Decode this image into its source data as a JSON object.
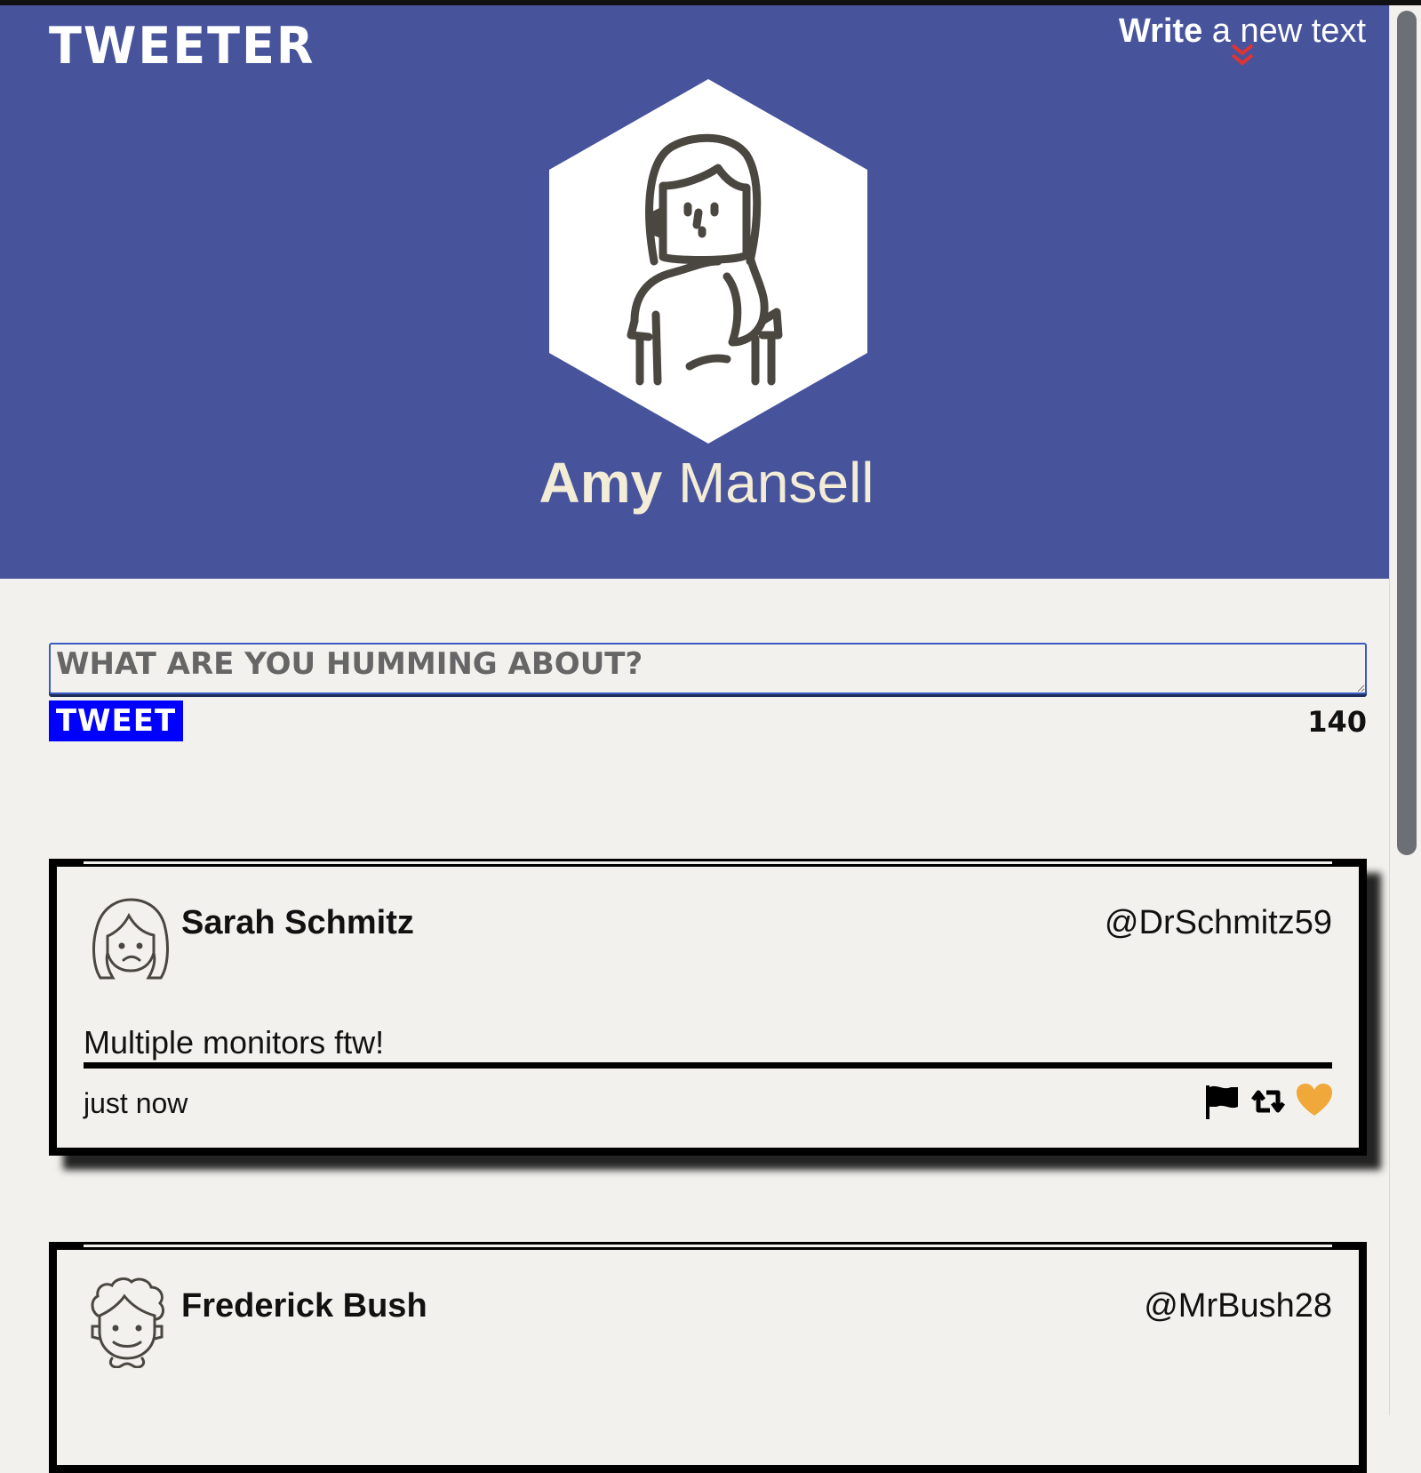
{
  "app": {
    "logo": "Tweeter"
  },
  "header": {
    "compose_link_bold": "Write",
    "compose_link_rest": " a new text",
    "compose_chevron_icon": "double-chevron-down-icon",
    "chevron_color": "#e03333",
    "background_color": "#47549c"
  },
  "profile": {
    "first_name": "Amy",
    "last_name": " Mansell",
    "avatar_icon": "woman-avatar-icon"
  },
  "composer": {
    "placeholder": "What are you humming about?",
    "value": "",
    "button_label": "Tweet",
    "char_count": "140",
    "button_color": "#0000ff"
  },
  "tweets": [
    {
      "name": "Sarah Schmitz",
      "handle": "@DrSchmitz59",
      "text": "Multiple monitors ftw!",
      "time": "just now",
      "avatar_icon": "woman-sad-avatar-icon",
      "actions": [
        "flag-icon",
        "retweet-icon",
        "heart-icon"
      ],
      "heart_color": "#f0a83a"
    },
    {
      "name": "Frederick Bush",
      "handle": "@MrBush28",
      "avatar_icon": "curly-hair-man-avatar-icon"
    }
  ]
}
